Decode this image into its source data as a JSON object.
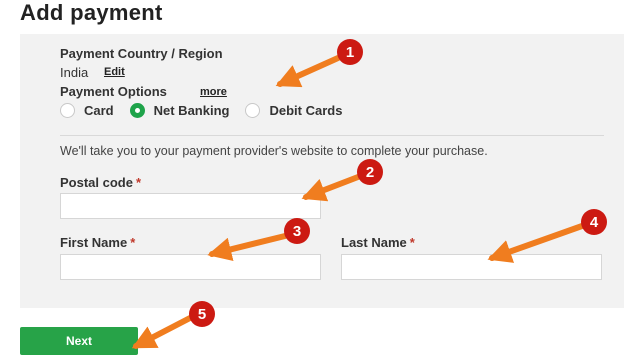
{
  "page": {
    "title": "Add payment"
  },
  "country": {
    "label": "Payment Country / Region",
    "value": "India",
    "edit_link": "Edit"
  },
  "payment_options": {
    "label": "Payment Options",
    "more_link": "more",
    "options": [
      "Card",
      "Net Banking",
      "Debit Cards"
    ],
    "selected": "Net Banking"
  },
  "notice": "We'll take you to your payment provider's website to complete your purchase.",
  "form": {
    "required_marker": "*",
    "postal_code": {
      "label": "Postal code",
      "value": ""
    },
    "first_name": {
      "label": "First Name",
      "value": ""
    },
    "last_name": {
      "label": "Last Name",
      "value": ""
    }
  },
  "next_button": "Next",
  "annotations": [
    "1",
    "2",
    "3",
    "4",
    "5"
  ],
  "colors": {
    "accent_green": "#27a348",
    "arrow_orange": "#f07d1f",
    "badge_red": "#cc1a12",
    "panel_bg": "#f2f2f2"
  }
}
